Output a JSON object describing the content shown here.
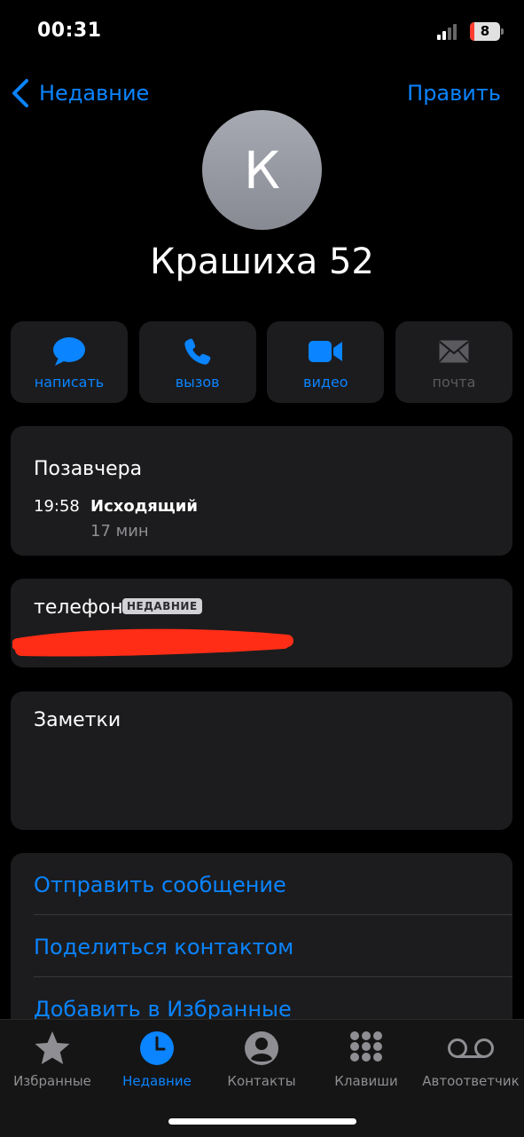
{
  "status": {
    "time": "00:31",
    "battery": "8"
  },
  "nav": {
    "back_label": "Недавние",
    "edit_label": "Править"
  },
  "contact": {
    "initial": "К",
    "name": "Крашиха 52"
  },
  "actions": [
    {
      "label": "написать",
      "icon": "message-bubble-icon",
      "enabled": true
    },
    {
      "label": "вызов",
      "icon": "phone-icon",
      "enabled": true
    },
    {
      "label": "видео",
      "icon": "video-camera-icon",
      "enabled": true
    },
    {
      "label": "почта",
      "icon": "envelope-icon",
      "enabled": false
    }
  ],
  "recent": {
    "day": "Позавчера",
    "time": "19:58",
    "type": "Исходящий",
    "duration": "17 мин"
  },
  "phone": {
    "label": "телефон",
    "badge": "НЕДАВНИЕ"
  },
  "notes": {
    "label": "Заметки"
  },
  "links": [
    {
      "label": "Отправить сообщение"
    },
    {
      "label": "Поделиться контактом"
    },
    {
      "label": "Добавить в Избранные"
    }
  ],
  "tabs": [
    {
      "label": "Избранные",
      "icon": "star-icon",
      "active": false
    },
    {
      "label": "Недавние",
      "icon": "clock-icon",
      "active": true
    },
    {
      "label": "Контакты",
      "icon": "person-circle-icon",
      "active": false
    },
    {
      "label": "Клавиши",
      "icon": "keypad-icon",
      "active": false
    },
    {
      "label": "Автоответчик",
      "icon": "voicemail-icon",
      "active": false
    }
  ],
  "colors": {
    "accent": "#0a84ff",
    "card": "#1c1c1e",
    "redaction": "#ff2d16"
  }
}
